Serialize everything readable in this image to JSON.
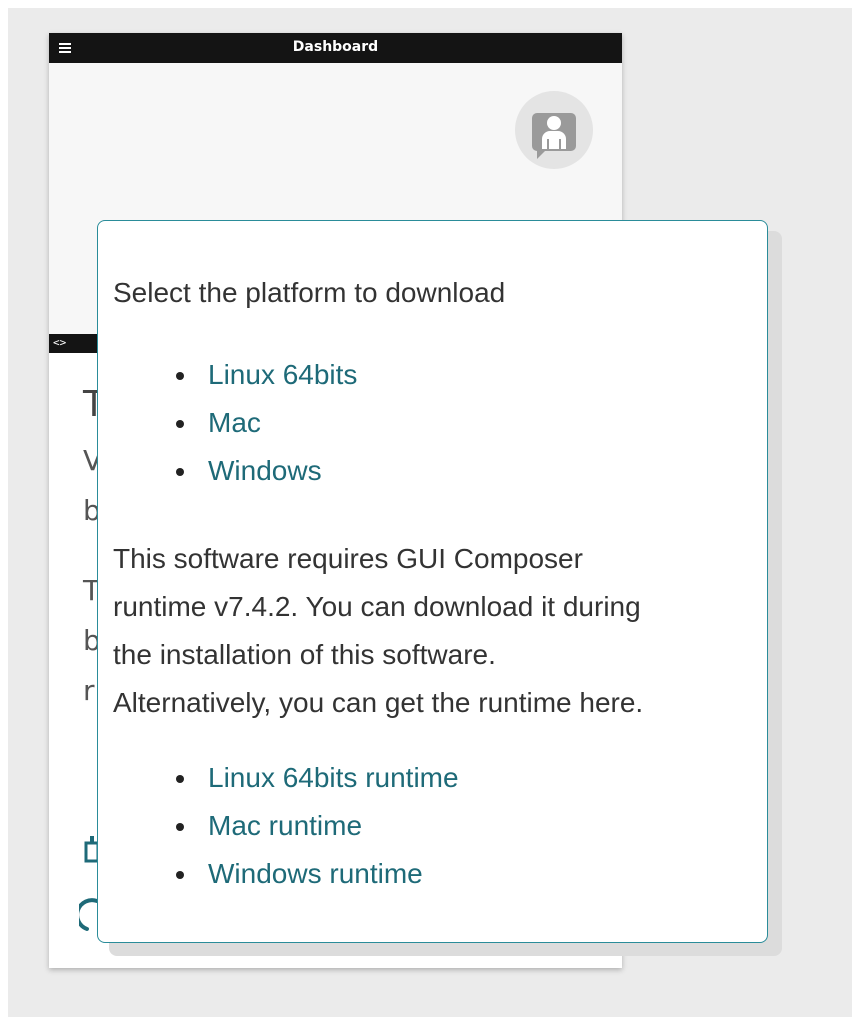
{
  "app": {
    "title": "Dashboard",
    "menu_icon": "hamburger-menu-icon",
    "avatar_icon": "user-avatar-icon",
    "code_icon_glyph": "<>"
  },
  "dialog": {
    "heading": "Select the platform to download",
    "platform_links": [
      "Linux 64bits",
      "Mac",
      "Windows"
    ],
    "runtime_notice_lines": [
      "This software requires GUI Composer",
      "runtime v7.4.2. You can download it during",
      "the installation of this software.",
      "Alternatively, you can get the runtime here."
    ],
    "runtime_links": [
      "Linux 64bits runtime",
      "Mac runtime",
      "Windows runtime"
    ]
  },
  "colors": {
    "accent": "#2a8c99",
    "link": "#1e6a78",
    "topbar": "#141414",
    "backdrop": "#ebebeb"
  }
}
